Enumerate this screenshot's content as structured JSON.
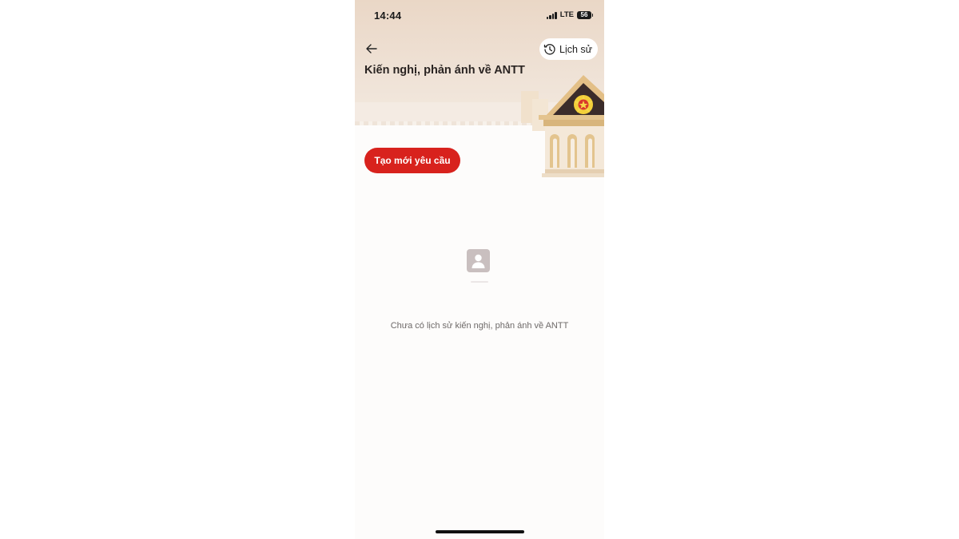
{
  "status_bar": {
    "time": "14:44",
    "network": "LTE",
    "battery": "56"
  },
  "header": {
    "back_icon": "arrow-left-icon",
    "history_icon": "clock-history-icon",
    "history_label": "Lịch sử",
    "title": "Kiến nghị, phản ánh về ANTT"
  },
  "actions": {
    "create_label": "Tạo mới yêu cầu"
  },
  "empty_state": {
    "icon": "user-placeholder-icon",
    "message": "Chưa có lịch sử kiến nghị, phản ánh về ANTT"
  },
  "colors": {
    "accent": "#d8221d",
    "header_bg": "#ead7c6",
    "empty_icon": "#c9bfbf"
  }
}
